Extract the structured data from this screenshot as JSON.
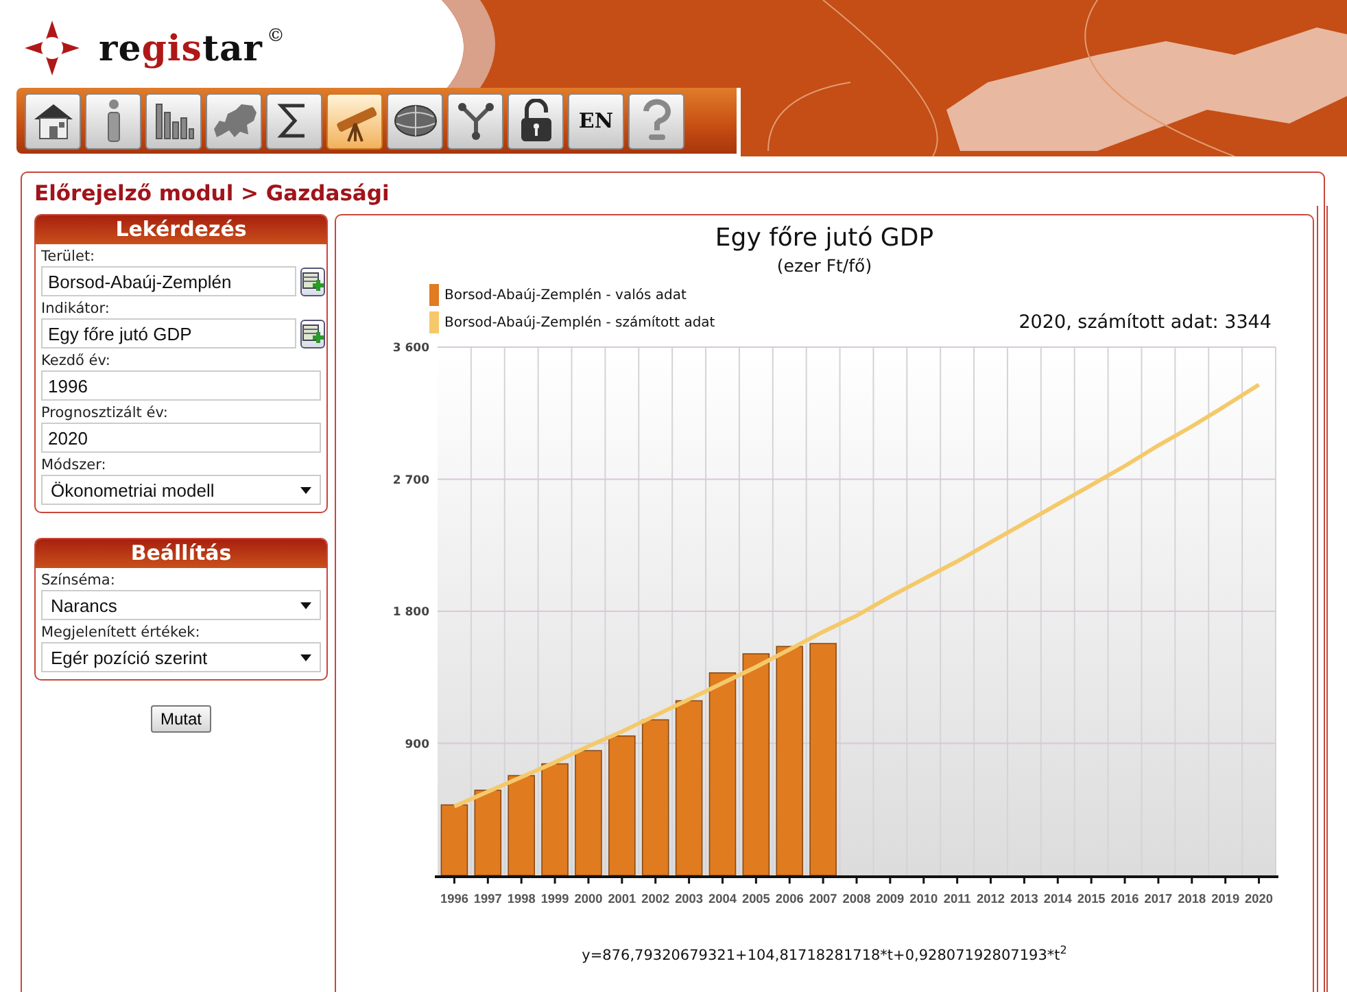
{
  "logo": {
    "prefix": "re",
    "highlight": "gis",
    "suffix": "tar",
    "mark": "©"
  },
  "toolbar": [
    {
      "kind": "home",
      "selected": false
    },
    {
      "kind": "info",
      "selected": false
    },
    {
      "kind": "bars",
      "selected": false
    },
    {
      "kind": "map",
      "selected": false
    },
    {
      "kind": "sum",
      "selected": false
    },
    {
      "kind": "telescope",
      "selected": true
    },
    {
      "kind": "globe",
      "selected": false
    },
    {
      "kind": "branch",
      "selected": false
    },
    {
      "kind": "lock",
      "selected": false
    },
    {
      "kind": "language",
      "label": "EN",
      "selected": false
    },
    {
      "kind": "help",
      "selected": false
    }
  ],
  "breadcrumb": "Előrejelző modul > Gazdasági",
  "panels": [
    {
      "title": "Lekérdezés",
      "fields": [
        {
          "kind": "picker",
          "label": "Terület:",
          "value": "Borsod-Abaúj-Zemplén"
        },
        {
          "kind": "picker",
          "label": "Indikátor:",
          "value": "Egy főre jutó GDP"
        },
        {
          "kind": "text",
          "label": "Kezdő év:",
          "value": "1996"
        },
        {
          "kind": "text",
          "label": "Prognosztizált év:",
          "value": "2020"
        },
        {
          "kind": "select",
          "label": "Módszer:",
          "value": "Ökonometriai modell"
        }
      ]
    },
    {
      "title": "Beállítás",
      "fields": [
        {
          "kind": "select",
          "label": "Színséma:",
          "value": "Narancs"
        },
        {
          "kind": "select",
          "label": "Megjelenített értékek:",
          "value": "Egér pozíció szerint"
        }
      ]
    }
  ],
  "submit_button": "Mutat",
  "chart": {
    "subtitle": "(ezer Ft/fő)",
    "readout": "2020, számított adat: 3344",
    "formula": "y=876,79320679321+104,81718281718*t+0,92807192807193*t",
    "formula_exponent": "2",
    "chart_data": {
      "type": "bar",
      "title": "Egy főre jutó GDP",
      "categories": [
        "1996",
        "1997",
        "1998",
        "1999",
        "2000",
        "2001",
        "2002",
        "2003",
        "2004",
        "2005",
        "2006",
        "2007",
        "2008",
        "2009",
        "2010",
        "2011",
        "2012",
        "2013",
        "2014",
        "2015",
        "2016",
        "2017",
        "2018",
        "2019",
        "2020"
      ],
      "series": [
        {
          "name": "Borsod-Abaúj-Zemplén - valós adat",
          "color": "#e07b20",
          "values": [
            480,
            580,
            680,
            760,
            850,
            950,
            1060,
            1190,
            1380,
            1510,
            1560,
            1580,
            null,
            null,
            null,
            null,
            null,
            null,
            null,
            null,
            null,
            null,
            null,
            null,
            null
          ]
        },
        {
          "name": "Borsod-Abaúj-Zemplén - számított adat",
          "color": "#f5c96a",
          "type": "line",
          "values": [
            470,
            570,
            670,
            770,
            880,
            980,
            1090,
            1200,
            1310,
            1420,
            1540,
            1660,
            1770,
            1900,
            2020,
            2140,
            2270,
            2400,
            2530,
            2660,
            2790,
            2930,
            3060,
            3200,
            3344
          ]
        }
      ],
      "grid": true,
      "ylim": [
        0,
        3600
      ],
      "yticks": [
        {
          "value": 900,
          "label": "900"
        },
        {
          "value": 1800,
          "label": "1 800"
        },
        {
          "value": 2700,
          "label": "2 700"
        },
        {
          "value": 3600,
          "label": "3 600"
        }
      ]
    }
  }
}
